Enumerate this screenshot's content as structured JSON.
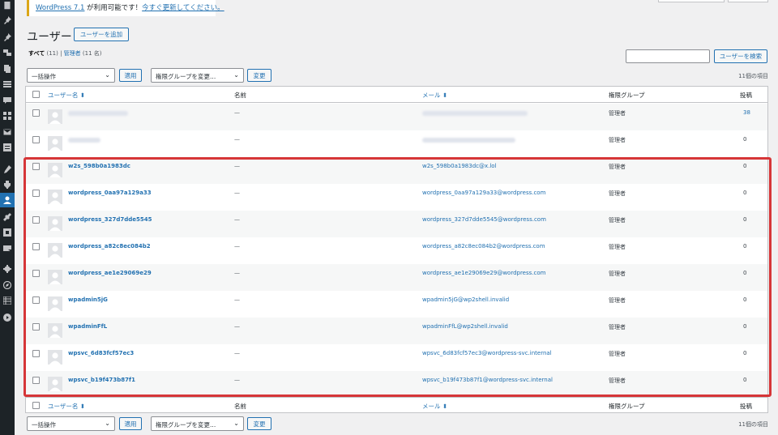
{
  "notice": {
    "version_link": "WordPress 7.1",
    "text_mid": " が利用可能です！",
    "update_link": "今すぐ更新してください。"
  },
  "header": {
    "title": "ユーザー",
    "add_new": "ユーザーを追加"
  },
  "filters": {
    "all_label": "すべて",
    "all_count": "(11)",
    "sep": "|",
    "admin_label": "管理者",
    "admin_count": "(11 名)"
  },
  "search": {
    "button": "ユーザーを検索",
    "value": ""
  },
  "bulk": {
    "action_label": "一括操作",
    "apply": "適用",
    "role_label": "権限グループを変更...",
    "change": "変更",
    "count": "11個の項目"
  },
  "columns": {
    "username": "ユーザー名",
    "name": "名前",
    "email": "メール",
    "role": "権限グループ",
    "posts": "投稿"
  },
  "icons": {
    "sort": "sort-arrows-icon",
    "dropdown": "chevron-down-icon",
    "avatar": "default-avatar-icon"
  },
  "colors": {
    "link": "#2271b1",
    "highlight": "#d63638",
    "menu_bg": "#1d2327",
    "menu_current": "#2271b1"
  },
  "users": [
    {
      "username": "",
      "name": "—",
      "email": "",
      "role": "管理者",
      "posts": "38",
      "blurred": true
    },
    {
      "username": "",
      "name": "—",
      "email": "",
      "role": "管理者",
      "posts": "0",
      "blurred": true
    },
    {
      "username": "w2s_598b0a1983dc",
      "name": "—",
      "email": "w2s_598b0a1983dc@x.lol",
      "role": "管理者",
      "posts": "0"
    },
    {
      "username": "wordpress_0aa97a129a33",
      "name": "—",
      "email": "wordpress_0aa97a129a33@wordpress.com",
      "role": "管理者",
      "posts": "0"
    },
    {
      "username": "wordpress_327d7dde5545",
      "name": "—",
      "email": "wordpress_327d7dde5545@wordpress.com",
      "role": "管理者",
      "posts": "0"
    },
    {
      "username": "wordpress_a82c8ec084b2",
      "name": "—",
      "email": "wordpress_a82c8ec084b2@wordpress.com",
      "role": "管理者",
      "posts": "0"
    },
    {
      "username": "wordpress_ae1e29069e29",
      "name": "—",
      "email": "wordpress_ae1e29069e29@wordpress.com",
      "role": "管理者",
      "posts": "0"
    },
    {
      "username": "wpadmin5jG",
      "name": "—",
      "email": "wpadmin5jG@wp2shell.invalid",
      "role": "管理者",
      "posts": "0"
    },
    {
      "username": "wpadminFfL",
      "name": "—",
      "email": "wpadminFfL@wp2shell.invalid",
      "role": "管理者",
      "posts": "0"
    },
    {
      "username": "wpsvc_6d83fcf57ec3",
      "name": "—",
      "email": "wpsvc_6d83fcf57ec3@wordpress-svc.internal",
      "role": "管理者",
      "posts": "0"
    },
    {
      "username": "wpsvc_b19f473b87f1",
      "name": "—",
      "email": "wpsvc_b19f473b87f1@wordpress-svc.internal",
      "role": "管理者",
      "posts": "0"
    }
  ]
}
